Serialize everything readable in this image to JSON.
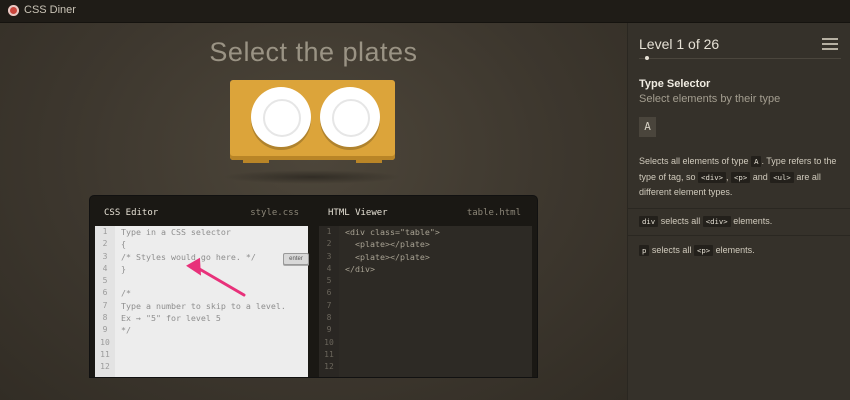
{
  "app": {
    "title": "CSS Diner"
  },
  "stage": {
    "order": "Select the plates"
  },
  "editor": {
    "css": {
      "title": "CSS Editor",
      "file": "style.css",
      "line_numbers": [
        "1",
        "2",
        "3",
        "4",
        "5",
        "6",
        "7",
        "8",
        "9",
        "10",
        "11",
        "12"
      ],
      "lines": [
        "Type in a CSS selector",
        "{",
        "/* Styles would go here. */",
        "}",
        "",
        "/*",
        "Type a number to skip to a level.",
        "Ex → \"5\" for level 5",
        "*/",
        "",
        "",
        ""
      ],
      "enter_label": "enter"
    },
    "html": {
      "title": "HTML Viewer",
      "file": "table.html",
      "line_numbers": [
        "1",
        "2",
        "3",
        "4",
        "5",
        "6",
        "7",
        "8",
        "9",
        "10",
        "11",
        "12"
      ],
      "lines": [
        "<div class=\"table\">",
        "  <plate></plate>",
        "  <plate></plate>",
        "</div>",
        "",
        "",
        "",
        "",
        "",
        "",
        "",
        ""
      ]
    }
  },
  "sidebar": {
    "level_title": "Level 1 of 26",
    "selector_name": "Type Selector",
    "selector_desc": "Select elements by their type",
    "syntax": "A",
    "hint": {
      "p1": "Selects all elements of type ",
      "tag_a": "A",
      "p2": ". Type refers to the type of tag, so ",
      "tag_div": "<div>",
      "p3": ", ",
      "tag_p": "<p>",
      "p4": " and ",
      "tag_ul": "<ul>",
      "p5": " are all different element types."
    },
    "examples": [
      {
        "sel": "div",
        "mid": " selects all ",
        "tag": "<div>",
        "end": " elements."
      },
      {
        "sel": "p",
        "mid": " selects all ",
        "tag": "<p>",
        "end": " elements."
      }
    ]
  },
  "colors": {
    "accent": "#dca43a",
    "annotation": "#e8317a"
  }
}
